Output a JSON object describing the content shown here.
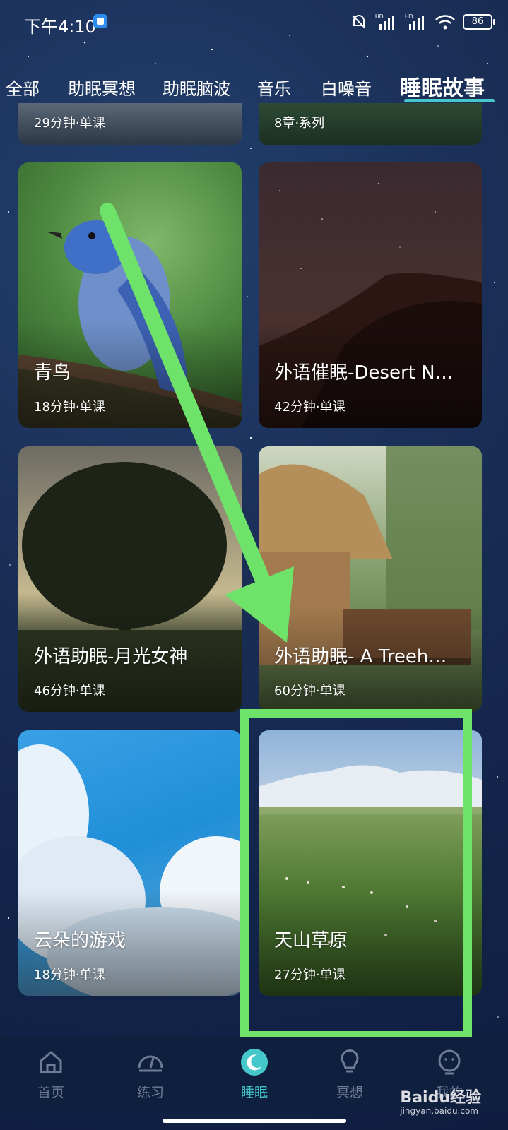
{
  "status_bar": {
    "time": "下午4:10",
    "battery": "86",
    "icons": [
      "app-notification-icon",
      "mute-bell-icon",
      "hd-signal-icon",
      "hd-signal-icon",
      "wifi-icon",
      "battery-icon"
    ]
  },
  "tabs": [
    {
      "label": "全部"
    },
    {
      "label": "助眠冥想"
    },
    {
      "label": "助眠脑波"
    },
    {
      "label": "音乐"
    },
    {
      "label": "白噪音"
    },
    {
      "label": "睡眠故事"
    }
  ],
  "active_tab": "睡眠故事",
  "partial_cards": [
    {
      "meta": "29分钟·单课"
    },
    {
      "meta": "8章·系列"
    }
  ],
  "cards": [
    {
      "title": "青鸟",
      "meta": "18分钟·单课",
      "image": "blue-bird-on-branch"
    },
    {
      "title": "外语催眠-Desert N…",
      "meta": "42分钟·单课",
      "image": "desert-night-sky"
    },
    {
      "title": "外语助眠-月光女神",
      "meta": "46分钟·单课",
      "image": "tree-at-sunset"
    },
    {
      "title": "外语助眠- A Treeh…",
      "meta": "60分钟·单课",
      "image": "thatched-treehouse"
    },
    {
      "title": "云朵的游戏",
      "meta": "18分钟·单课",
      "image": "blue-sky-clouds"
    },
    {
      "title": "天山草原",
      "meta": "27分钟·单课",
      "image": "tianshan-grassland"
    }
  ],
  "bottom_nav": [
    {
      "label": "首页",
      "icon": "home-icon"
    },
    {
      "label": "练习",
      "icon": "gauge-icon"
    },
    {
      "label": "睡眠",
      "icon": "moon-icon"
    },
    {
      "label": "冥想",
      "icon": "lightbulb-icon"
    },
    {
      "label": "我的",
      "icon": "profile-icon"
    }
  ],
  "active_nav": "睡眠",
  "annotation": {
    "arrow_color": "#6fe26a",
    "highlight_color": "#6fe26a"
  },
  "watermark": {
    "brand": "Baidu经验",
    "url": "jingyan.baidu.com"
  }
}
